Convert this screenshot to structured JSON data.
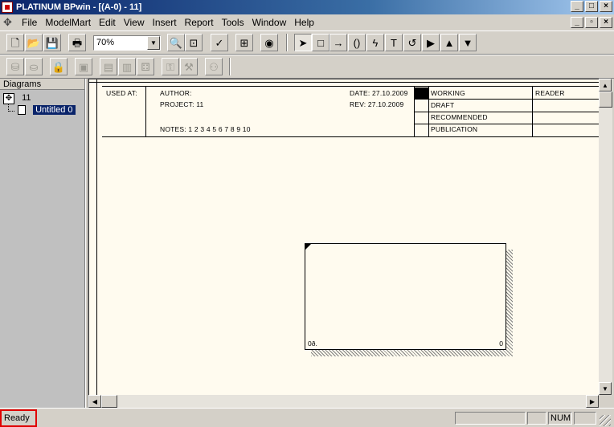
{
  "window": {
    "title": "PLATINUM BPwin - [(A-0)  - 11]",
    "buttons": [
      "_",
      "□",
      "×"
    ],
    "child_buttons": [
      "_",
      "▫",
      "×"
    ]
  },
  "menu": {
    "items": [
      "File",
      "ModelMart",
      "Edit",
      "View",
      "Insert",
      "Report",
      "Tools",
      "Window",
      "Help"
    ]
  },
  "toolbar": {
    "zoom_value": "70%"
  },
  "tree": {
    "header": "Diagrams",
    "root_label": "11",
    "child_label": "Untitled 0"
  },
  "frame": {
    "used_at": "USED AT:",
    "author": "AUTHOR:",
    "project": "PROJECT:  11",
    "notes": "NOTES:  1  2  3  4  5  6  7  8  9  10",
    "date": "DATE:  27.10.2009",
    "rev": "REV:   27.10.2009",
    "working": "WORKING",
    "draft": "DRAFT",
    "recommended": "RECOMMENDED",
    "publication": "PUBLICATION",
    "reader": "READER"
  },
  "box": {
    "label_left": "0ð.",
    "label_right": "0"
  },
  "status": {
    "ready": "Ready",
    "num": "NUM"
  },
  "colors": {
    "canvas_bg": "#fffbef",
    "titlebar_start": "#0a246a",
    "selection": "#0a246a",
    "highlight_border": "#e00000"
  }
}
